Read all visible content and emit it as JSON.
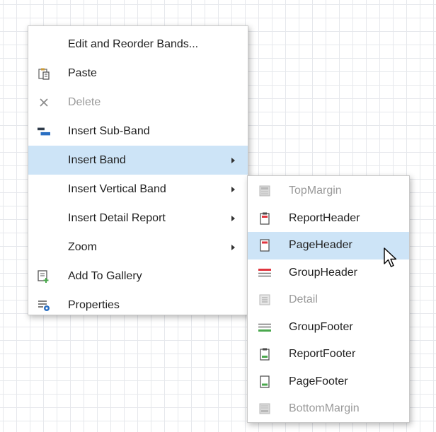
{
  "context_menu": {
    "items": [
      {
        "label": "Edit and Reorder Bands...",
        "icon": "none"
      },
      {
        "label": "Paste",
        "icon": "clipboard-paste-icon"
      },
      {
        "label": "Delete",
        "icon": "delete-x-icon",
        "disabled": true
      },
      {
        "label": "Insert Sub-Band",
        "icon": "insert-sub-band-icon"
      },
      {
        "label": "Insert Band",
        "icon": "none",
        "submenu": true,
        "highlighted": true
      },
      {
        "label": "Insert Vertical Band",
        "icon": "none",
        "submenu": true
      },
      {
        "label": "Insert Detail Report",
        "icon": "none",
        "submenu": true
      },
      {
        "label": "Zoom",
        "icon": "none",
        "submenu": true
      },
      {
        "label": "Add To Gallery",
        "icon": "add-to-gallery-icon"
      },
      {
        "label": "Properties",
        "icon": "properties-icon"
      }
    ]
  },
  "insert_band_submenu": {
    "items": [
      {
        "label": "TopMargin",
        "icon": "band-top-margin-icon",
        "disabled": true
      },
      {
        "label": "ReportHeader",
        "icon": "band-report-header-icon"
      },
      {
        "label": "PageHeader",
        "icon": "band-page-header-icon",
        "highlighted": true
      },
      {
        "label": "GroupHeader",
        "icon": "band-group-header-icon"
      },
      {
        "label": "Detail",
        "icon": "band-detail-icon",
        "disabled": true
      },
      {
        "label": "GroupFooter",
        "icon": "band-group-footer-icon"
      },
      {
        "label": "ReportFooter",
        "icon": "band-report-footer-icon"
      },
      {
        "label": "PageFooter",
        "icon": "band-page-footer-icon"
      },
      {
        "label": "BottomMargin",
        "icon": "band-bottom-margin-icon",
        "disabled": true
      }
    ]
  },
  "colors": {
    "highlight": "#cde4f7",
    "menu_border": "#c9c9c9",
    "disabled_text": "#9a9a9a",
    "band_red": "#e0353f",
    "band_green": "#4aa84d",
    "band_blue": "#2a6fc2"
  }
}
